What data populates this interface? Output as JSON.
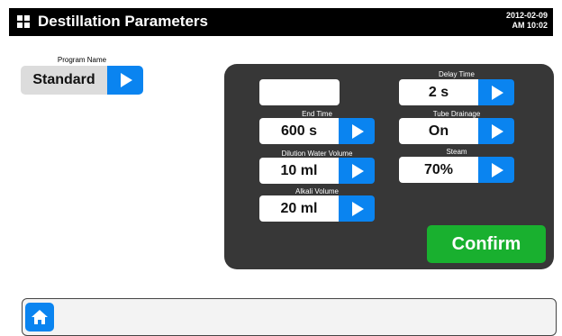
{
  "header": {
    "title": "Destillation Parameters",
    "date": "2012-02-09",
    "time": "AM 10:02"
  },
  "program": {
    "label": "Program Name",
    "value": "Standard"
  },
  "parameters": {
    "end_time": {
      "label": "End Time",
      "value": "600 s"
    },
    "dilution_water_volume": {
      "label": "Dilution Water Volume",
      "value": "10 ml"
    },
    "alkali_volume": {
      "label": "Alkali Volume",
      "value": "20 ml"
    },
    "delay_time": {
      "label": "Delay Time",
      "value": "2 s"
    },
    "tube_drainage": {
      "label": "Tube Drainage",
      "value": "On"
    },
    "steam": {
      "label": "Steam",
      "value": "70%"
    }
  },
  "confirm_label": "Confirm",
  "icons": {
    "app": "grid-icon",
    "arrow": "play-arrow-icon",
    "home": "home-icon"
  },
  "colors": {
    "accent_blue": "#0a84f0",
    "confirm_green": "#19b02f",
    "panel": "#373737",
    "titlebar": "#000000"
  }
}
